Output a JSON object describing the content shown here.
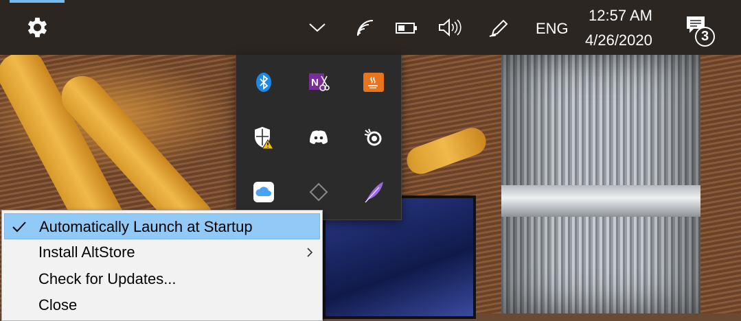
{
  "taskbar": {
    "settings_icon": "gear-icon",
    "overflow_chevron_icon": "chevron-up-icon",
    "network_icon": "wifi-icon",
    "battery_icon": "battery-icon",
    "volume_icon": "speaker-icon",
    "pen_icon": "pen-workspace-icon",
    "language": "ENG",
    "time": "12:57 AM",
    "date": "4/26/2020",
    "notification_count": "3",
    "notification_icon": "action-center-icon"
  },
  "tray_flyout": {
    "icons": [
      "bluetooth-icon",
      "onenote-clipping-icon",
      "java-icon",
      "windows-security-warning-icon",
      "discord-icon",
      "steelseries-icon",
      "icloud-icon",
      "altserver-diamond-icon",
      "feather-icon"
    ]
  },
  "context_menu": {
    "items": [
      {
        "label": "Automatically Launch at Startup",
        "checked": true,
        "highlighted": true
      },
      {
        "label": "Install AltStore",
        "submenu": true
      },
      {
        "label": "Check for Updates..."
      },
      {
        "label": "Close"
      }
    ]
  },
  "colors": {
    "taskbar_bg": "#2b2622",
    "flyout_bg": "#2b2b2b",
    "menu_bg": "#f2f2f2",
    "menu_highlight": "#91c9f7",
    "accent": "#76b9ed"
  }
}
